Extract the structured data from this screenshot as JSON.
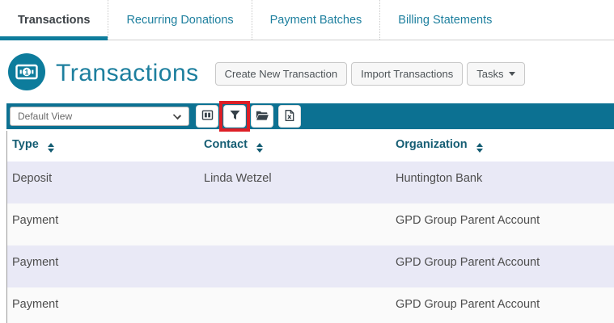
{
  "tabs": [
    {
      "label": "Transactions",
      "active": true
    },
    {
      "label": "Recurring Donations",
      "active": false
    },
    {
      "label": "Payment Batches",
      "active": false
    },
    {
      "label": "Billing Statements",
      "active": false
    }
  ],
  "header": {
    "title": "Transactions",
    "icon": "money-bill-icon",
    "buttons": {
      "create": "Create New Transaction",
      "import": "Import Transactions",
      "tasks": "Tasks"
    }
  },
  "toolbar": {
    "view_select": {
      "value": "Default View"
    },
    "icons": [
      {
        "name": "columns-icon"
      },
      {
        "name": "filter-icon",
        "highlighted": true
      },
      {
        "name": "folder-open-icon"
      },
      {
        "name": "excel-export-icon"
      }
    ]
  },
  "table": {
    "columns": [
      {
        "label": "Type",
        "sortable": true
      },
      {
        "label": "Contact",
        "sortable": true
      },
      {
        "label": "Organization",
        "sortable": true
      }
    ],
    "rows": [
      {
        "type": "Deposit",
        "contact": "Linda Wetzel",
        "organization": "Huntington Bank"
      },
      {
        "type": "Payment",
        "contact": "",
        "organization": "GPD Group Parent Account"
      },
      {
        "type": "Payment",
        "contact": "",
        "organization": "GPD Group Parent Account"
      },
      {
        "type": "Payment",
        "contact": "",
        "organization": "GPD Group Parent Account"
      }
    ]
  },
  "colors": {
    "accent_teal": "#1d7f9e",
    "toolbar_teal": "#0c7192",
    "tab_underline": "#0d7c9c",
    "header_text": "#155d73",
    "highlight_red": "#dd1f26",
    "row_alt": "#e9e9f6"
  }
}
